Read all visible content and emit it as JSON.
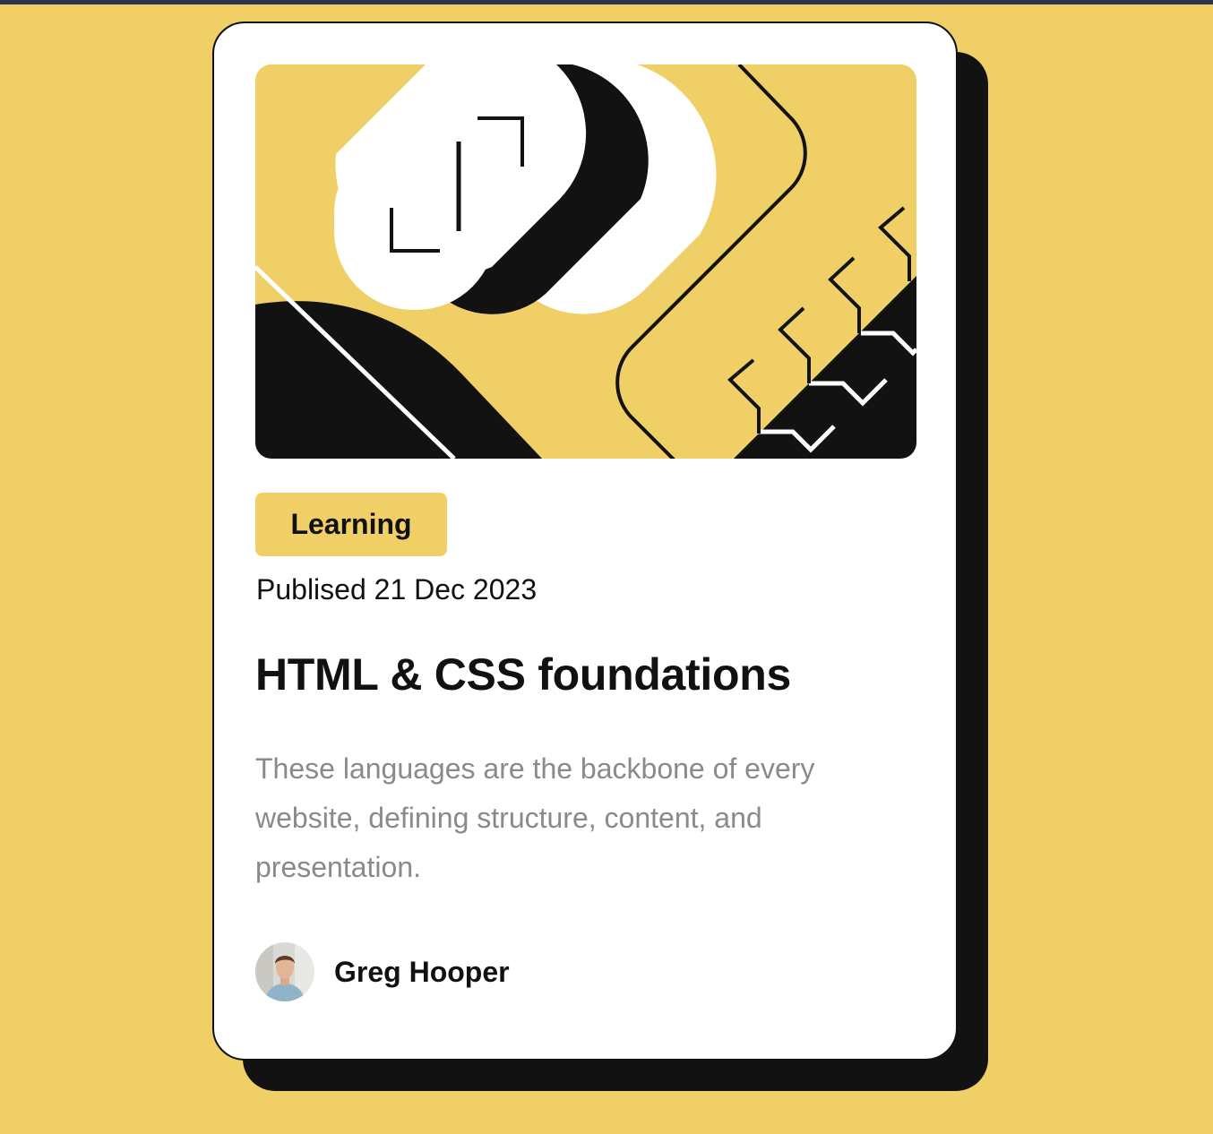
{
  "card": {
    "tag": "Learning",
    "published": "Publised 21 Dec 2023",
    "title": "HTML & CSS foundations",
    "description": "These languages are the backbone of every website, defining structure, content, and presentation.",
    "author": {
      "name": "Greg Hooper"
    }
  },
  "colors": {
    "background": "#F0D066",
    "card": "#FFFFFF",
    "ink": "#121212",
    "muted_text": "#8a8a8a",
    "tag_background": "#F0D066"
  },
  "icons": {
    "hero_illustration": "illustration-article",
    "avatar": "image-avatar"
  }
}
